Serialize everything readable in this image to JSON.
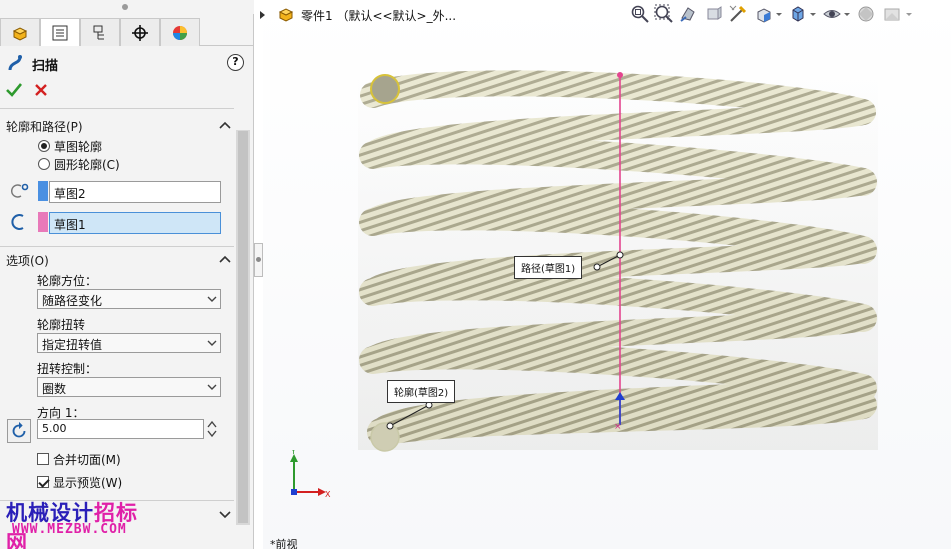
{
  "property_manager": {
    "tabs": [
      "feature-manager",
      "property-manager",
      "configuration-manager",
      "dimxpert-manager",
      "display-manager"
    ],
    "feature_title": "扫描",
    "help_label": "?",
    "profile_group": {
      "title": "轮廓和路径(P)",
      "radio_sketch_profile": "草图轮廓",
      "radio_circular_profile": "圆形轮廓(C)",
      "profile_selection": "草图2",
      "path_selection": "草图1"
    },
    "options_group": {
      "title": "选项(O)",
      "orientation_label": "轮廓方位：",
      "orientation_value": "随路径变化",
      "twist_label": "轮廓扭转",
      "twist_value": "指定扭转值",
      "twist_control_label": "扭转控制：",
      "twist_control_value": "圈数",
      "direction_label": "方向 1：",
      "direction_value": "5.00",
      "merge_tangent_faces": "合并切面(M)",
      "show_preview": "显示预览(W)"
    },
    "colors": {
      "profile_swatch": "#4a90e2",
      "path_swatch": "#e879b9",
      "active_field": "#cfe6f7"
    }
  },
  "graphics": {
    "part_label": "零件1 （默认<<默认>_外...",
    "callout_path": "路径(草图1)",
    "callout_profile": "轮廓(草图2)",
    "bottom_label": "*前视",
    "axes": {
      "x": "X",
      "y": "Y",
      "z": "Z"
    }
  },
  "watermark": {
    "top_part1": "机械设计",
    "top_part2": "招标网",
    "bottom": "WWW.MEZBW.COM"
  }
}
